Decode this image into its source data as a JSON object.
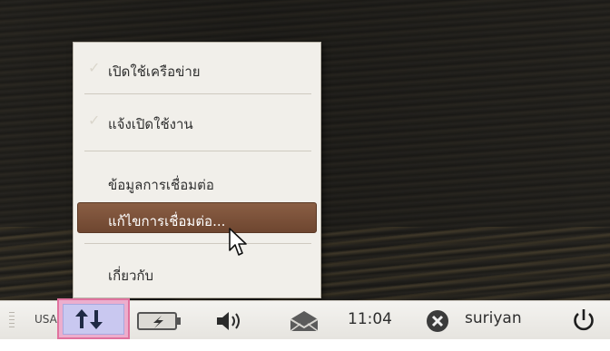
{
  "menu": {
    "items": [
      {
        "label": "เปิดใช้เครือข่าย",
        "checked": true
      },
      {
        "label": "แจ้งเปิดใช้งาน",
        "checked": true
      },
      {
        "label": "ข้อมูลการเชื่อมต่อ",
        "checked": false
      },
      {
        "label": "แก้ไขการเชื่อมต่อ...",
        "checked": false,
        "highlighted": true
      },
      {
        "label": "เกี่ยวกับ",
        "checked": false
      }
    ],
    "check_glyph": "✓",
    "highlight_color": "#7a4f38"
  },
  "taskbar": {
    "keyboard_layout": "USA",
    "clock": "11:04",
    "username": "suriyan",
    "icons": [
      "network-icon",
      "battery-icon",
      "volume-icon",
      "mail-icon",
      "user-status-icon",
      "power-icon"
    ],
    "network_highlight_color": "#e0729e"
  }
}
